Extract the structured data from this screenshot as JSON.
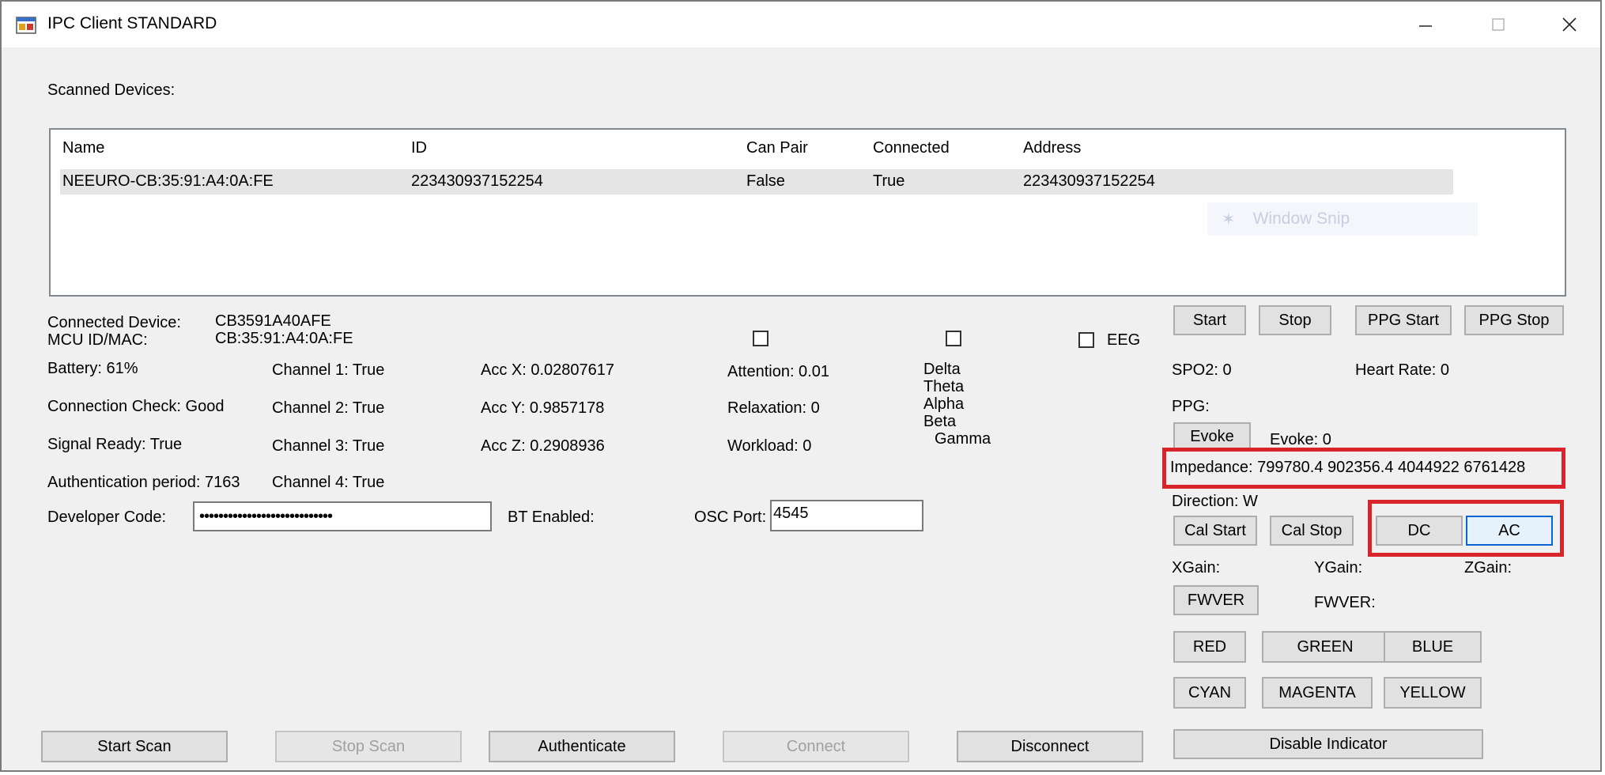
{
  "window": {
    "title": "IPC Client STANDARD"
  },
  "scanned_label": "Scanned Devices:",
  "devices": {
    "columns": [
      "Name",
      "ID",
      "Can Pair",
      "Connected",
      "Address"
    ],
    "rows": [
      [
        "NEEURO-CB:35:91:A4:0A:FE",
        "223430937152254",
        "False",
        "True",
        "223430937152254"
      ]
    ]
  },
  "overlay": {
    "window_snip": "Window Snip"
  },
  "device_info": {
    "connected_device_label": "Connected Device:",
    "connected_device_value": "CB3591A40AFE",
    "mcu_label": "MCU ID/MAC:",
    "mcu_value": "CB:35:91:A4:0A:FE",
    "battery": "Battery: 61%",
    "connection_check": "Connection Check: Good",
    "signal_ready": "Signal Ready: True",
    "auth_period": "Authentication period: 7163"
  },
  "channels": [
    "Channel 1: True",
    "Channel 2: True",
    "Channel 3: True",
    "Channel 4: True"
  ],
  "acc": [
    "Acc X: 0.02807617",
    "Acc Y: 0.9857178",
    "Acc Z: 0.2908936"
  ],
  "metrics": [
    "Attention: 0.01",
    "Relaxation: 0",
    "Workload: 0"
  ],
  "bands": [
    "Delta",
    "Theta",
    "Alpha",
    "Beta",
    "Gamma"
  ],
  "eeg_label": "EEG",
  "developer": {
    "label": "Developer Code:",
    "value": "••••••••••••••••••••••••••••"
  },
  "bt_enabled": "BT Enabled:",
  "osc": {
    "label": "OSC Port:",
    "value": "4545"
  },
  "right": {
    "start": "Start",
    "stop": "Stop",
    "ppg_start": "PPG Start",
    "ppg_stop": "PPG Stop",
    "spo2": "SPO2: 0",
    "heart_rate": "Heart Rate: 0",
    "ppg": "PPG:",
    "evoke_btn": "Evoke",
    "evoke_val": "Evoke: 0",
    "impedance": "Impedance: 799780.4 902356.4 4044922 6761428",
    "direction": "Direction: W",
    "cal_start": "Cal Start",
    "cal_stop": "Cal Stop",
    "dc": "DC",
    "ac": "AC",
    "xgain": "XGain:",
    "ygain": "YGain:",
    "zgain": "ZGain:",
    "fwver_btn": "FWVER",
    "fwver_label": "FWVER:",
    "red": "RED",
    "green": "GREEN",
    "blue": "BLUE",
    "cyan": "CYAN",
    "magenta": "MAGENTA",
    "yellow": "YELLOW",
    "disable_indicator": "Disable Indicator"
  },
  "bottom": {
    "start_scan": "Start Scan",
    "stop_scan": "Stop Scan",
    "authenticate": "Authenticate",
    "connect": "Connect",
    "disconnect": "Disconnect"
  },
  "colors": {
    "highlight": "#d9242b",
    "focus": "#0a64d2"
  }
}
